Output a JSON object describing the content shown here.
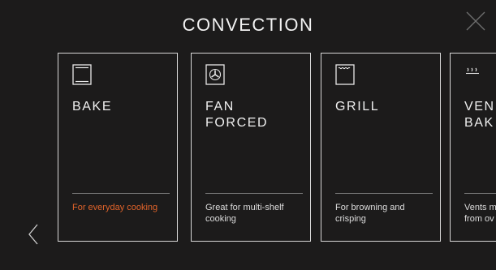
{
  "header": {
    "title": "CONVECTION"
  },
  "modes": [
    {
      "name": "BAKE",
      "description": "For everyday cooking",
      "icon": "bake-icon",
      "selected": true
    },
    {
      "name": "FAN\nFORCED",
      "description": "Great for multi-shelf cooking",
      "icon": "fan-icon",
      "selected": false
    },
    {
      "name": "GRILL",
      "description": "For browning and crisping",
      "icon": "grill-icon",
      "selected": false
    },
    {
      "name": "VEN\nBAK",
      "description": "Vents m\nfrom ov",
      "icon": "vent-icon",
      "selected": false
    }
  ],
  "colors": {
    "background": "#1c1b1b",
    "accent": "#e0632a",
    "card_border": "#d7d7d7"
  }
}
